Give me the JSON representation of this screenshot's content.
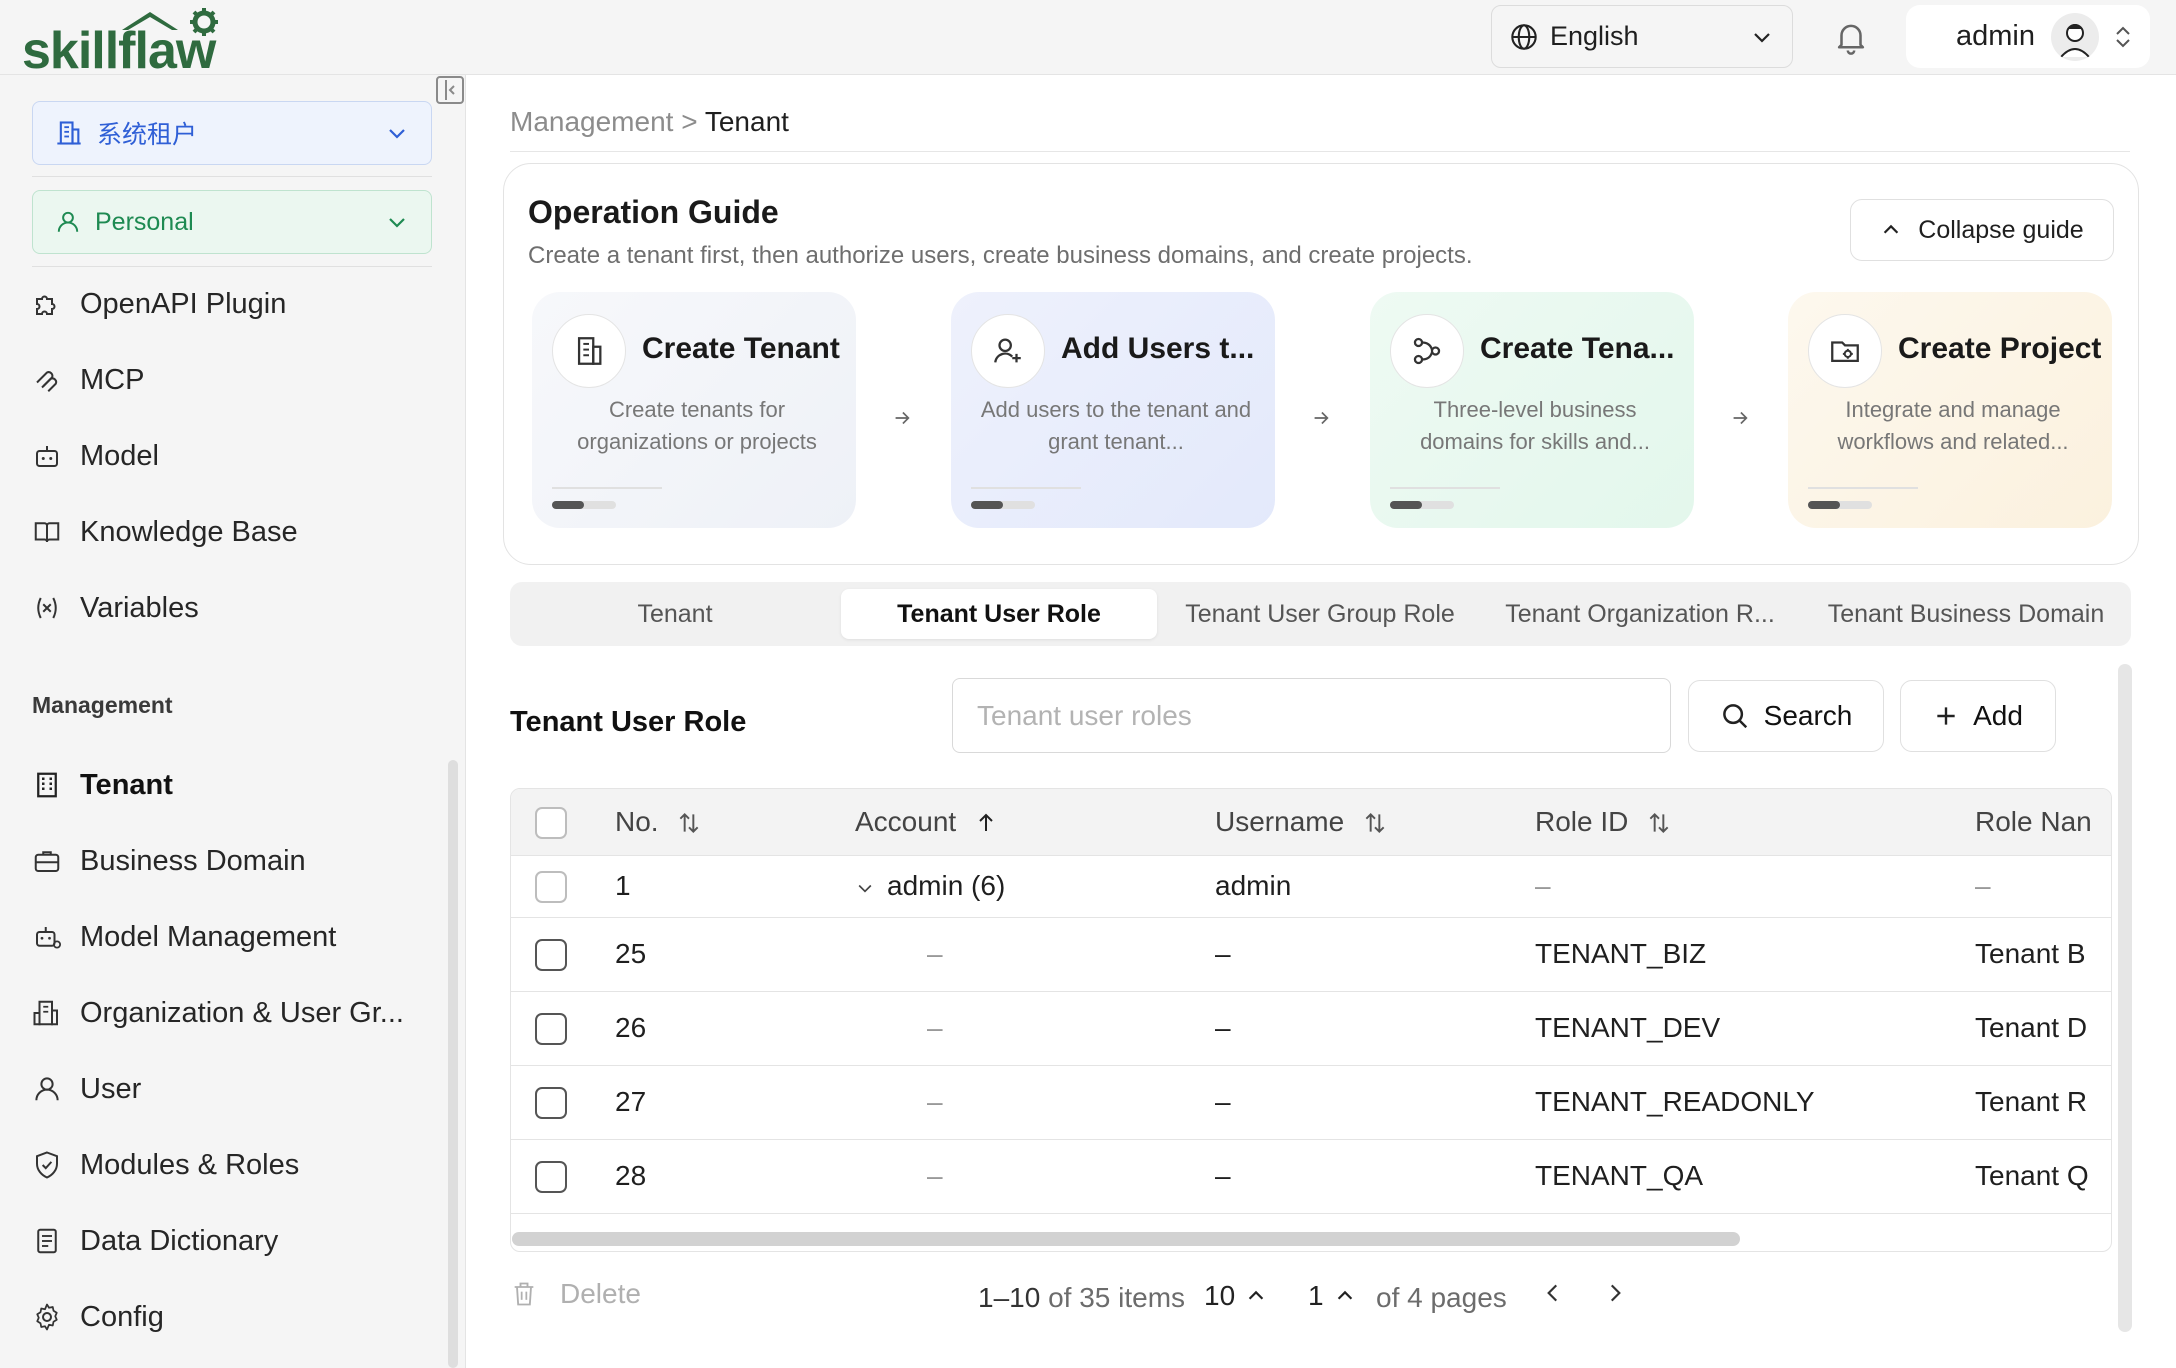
{
  "header": {
    "logo_text": "skillflaw",
    "language": "English",
    "user_name": "admin"
  },
  "sidebar": {
    "tenant_selector": "系统租户",
    "space_selector": "Personal",
    "items": [
      {
        "label": "OpenAPI Plugin",
        "icon": "puzzle-icon"
      },
      {
        "label": "MCP",
        "icon": "mcp-link-icon"
      },
      {
        "label": "Model",
        "icon": "robot-icon"
      },
      {
        "label": "Knowledge Base",
        "icon": "book-icon"
      },
      {
        "label": "Variables",
        "icon": "variable-icon"
      }
    ],
    "management_title": "Management",
    "management_items": [
      {
        "label": "Tenant",
        "icon": "building-icon",
        "active": true
      },
      {
        "label": "Business Domain",
        "icon": "briefcase-icon"
      },
      {
        "label": "Model Management",
        "icon": "robot-gear-icon"
      },
      {
        "label": "Organization & User Gr...",
        "icon": "org-icon"
      },
      {
        "label": "User",
        "icon": "user-icon"
      },
      {
        "label": "Modules & Roles",
        "icon": "shield-icon"
      },
      {
        "label": "Data Dictionary",
        "icon": "dictionary-icon"
      },
      {
        "label": "Config",
        "icon": "gear-icon"
      }
    ]
  },
  "breadcrumb": {
    "parent": "Management",
    "separator": ">",
    "current": "Tenant"
  },
  "guide": {
    "title": "Operation Guide",
    "subtitle": "Create a tenant first, then authorize users, create business domains, and create projects.",
    "collapse_label": "Collapse guide",
    "steps": [
      {
        "title": "Create Tenant",
        "desc": "Create tenants for organizations or projects",
        "icon": "building-icon"
      },
      {
        "title": "Add Users t...",
        "desc": "Add users to the tenant and grant tenant...",
        "icon": "user-add-icon"
      },
      {
        "title": "Create Tena...",
        "desc": "Three-level business domains for skills and...",
        "icon": "flow-icon"
      },
      {
        "title": "Create Project",
        "desc": "Integrate and manage workflows and related...",
        "icon": "project-icon"
      }
    ]
  },
  "tabs": [
    "Tenant",
    "Tenant User Role",
    "Tenant User Group Role",
    "Tenant Organization R...",
    "Tenant Business Domain"
  ],
  "active_tab": 1,
  "table_section": {
    "title": "Tenant User Role",
    "search_placeholder": "Tenant user roles",
    "search_button": "Search",
    "add_button": "Add"
  },
  "table": {
    "columns": [
      "No.",
      "Account",
      "Username",
      "Role ID",
      "Role Nan"
    ],
    "rows": [
      {
        "no": "1",
        "account": "admin (6)",
        "username": "admin",
        "role_id": "–",
        "role_name": "–"
      },
      {
        "no": "25",
        "account": "–",
        "username": "–",
        "role_id": "TENANT_BIZ",
        "role_name": "Tenant B"
      },
      {
        "no": "26",
        "account": "–",
        "username": "–",
        "role_id": "TENANT_DEV",
        "role_name": "Tenant D"
      },
      {
        "no": "27",
        "account": "–",
        "username": "–",
        "role_id": "TENANT_READONLY",
        "role_name": "Tenant R"
      },
      {
        "no": "28",
        "account": "–",
        "username": "–",
        "role_id": "TENANT_QA",
        "role_name": "Tenant Q"
      }
    ]
  },
  "footer": {
    "delete_label": "Delete",
    "range_text": "1–10",
    "range_suffix": "of 35 items",
    "page_size": "10",
    "current_page": "1",
    "pages_text": "of 4 pages"
  },
  "colors": {
    "tenant_selector_text": "#2f5fd6",
    "personal_selector_text": "#1e8a52",
    "logo_green": "#2f6b3f"
  }
}
